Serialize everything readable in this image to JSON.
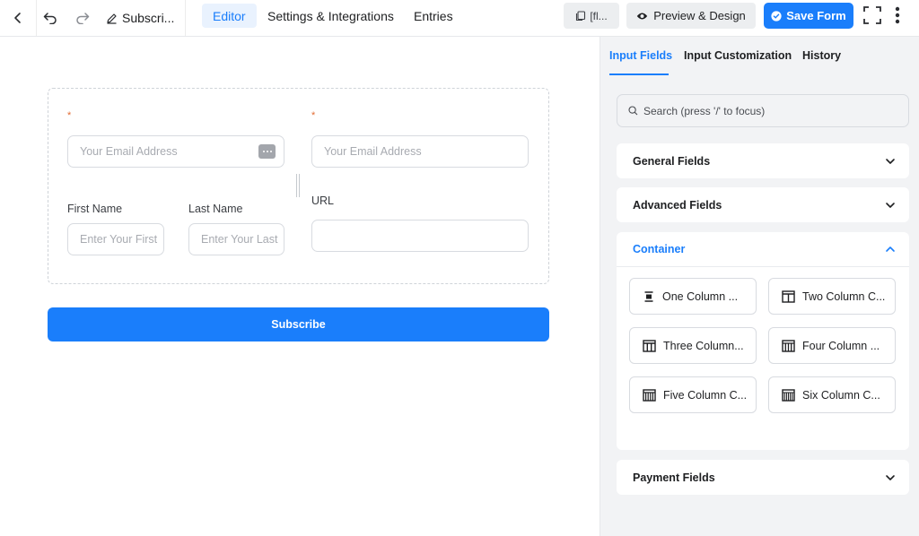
{
  "topbar": {
    "form_title": "Subscri...",
    "tabs": [
      {
        "label": "Editor",
        "active": true
      },
      {
        "label": "Settings & Integrations",
        "active": false
      },
      {
        "label": "Entries",
        "active": false
      }
    ],
    "shortcode_label": "[fl...",
    "preview_label": "Preview & Design",
    "save_label": "Save Form"
  },
  "form": {
    "required_mark": "*",
    "email_placeholder": "Your Email Address",
    "email2_placeholder": "Your Email Address",
    "first_name_label": "First Name",
    "first_name_placeholder": "Enter Your First",
    "last_name_label": "Last Name",
    "last_name_placeholder": "Enter Your Last",
    "url_label": "URL",
    "submit_label": "Subscribe"
  },
  "panel": {
    "tabs": [
      {
        "label": "Input Fields",
        "active": true
      },
      {
        "label": "Input Customization",
        "active": false
      },
      {
        "label": "History",
        "active": false
      }
    ],
    "search_placeholder": "Search (press '/' to focus)",
    "sections": {
      "general": "General Fields",
      "advanced": "Advanced Fields",
      "container": "Container",
      "payment": "Payment Fields"
    },
    "container_items": [
      {
        "label": "One Column ...",
        "icon": "one-column-icon"
      },
      {
        "label": "Two Column C...",
        "icon": "two-column-icon"
      },
      {
        "label": "Three Column...",
        "icon": "three-column-icon"
      },
      {
        "label": "Four Column ...",
        "icon": "four-column-icon"
      },
      {
        "label": "Five Column C...",
        "icon": "five-column-icon"
      },
      {
        "label": "Six Column C...",
        "icon": "six-column-icon"
      }
    ]
  },
  "colors": {
    "accent": "#1a7efb",
    "required": "#e26b34"
  }
}
